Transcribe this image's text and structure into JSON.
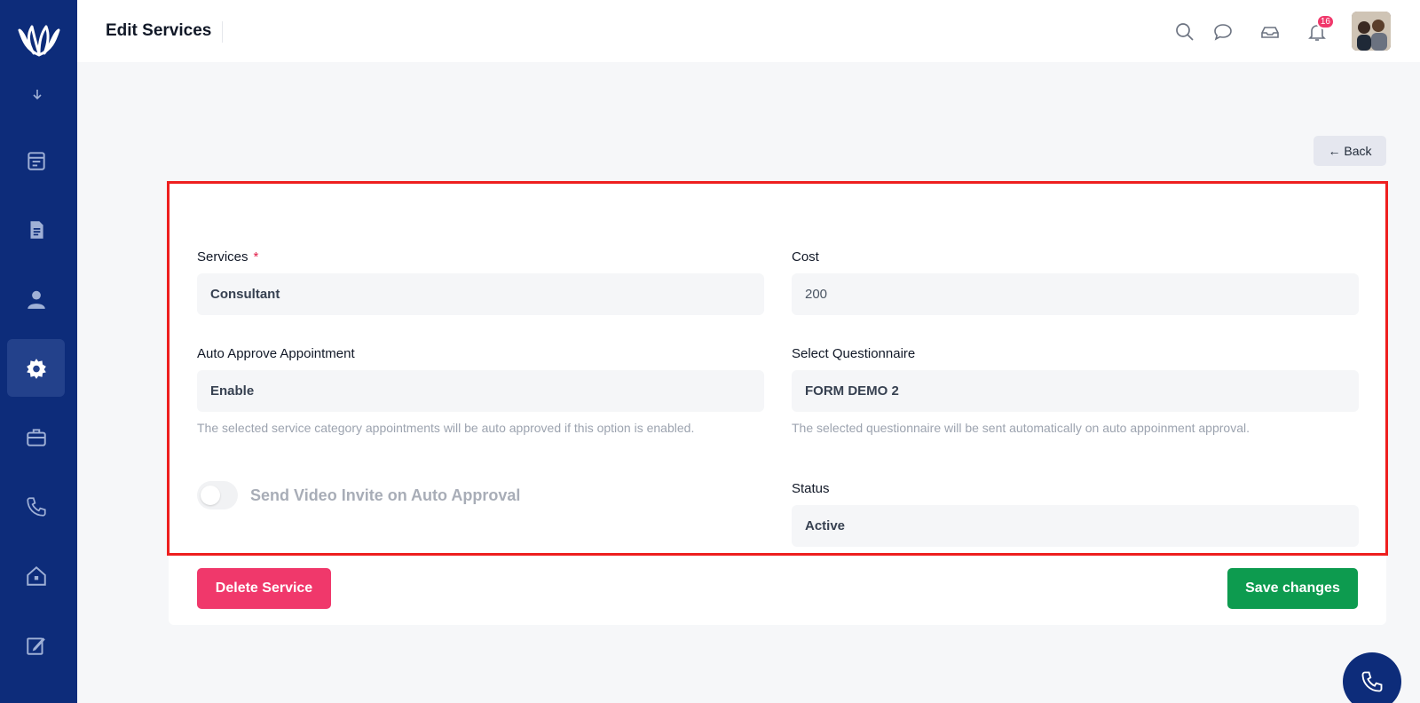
{
  "header": {
    "title": "Edit Services",
    "notification_count": "16"
  },
  "sidebar": {
    "items": [
      {
        "icon": "calendar-icon",
        "active": false
      },
      {
        "icon": "document-icon",
        "active": false
      },
      {
        "icon": "user-icon",
        "active": false
      },
      {
        "icon": "gear-icon",
        "active": true
      },
      {
        "icon": "briefcase-icon",
        "active": false
      },
      {
        "icon": "phone-icon",
        "active": false
      },
      {
        "icon": "home-icon",
        "active": false
      },
      {
        "icon": "edit-icon",
        "active": false
      }
    ]
  },
  "actions": {
    "back_label": "← Back"
  },
  "form": {
    "services": {
      "label": "Services",
      "required_mark": "*",
      "value": "Consultant"
    },
    "cost": {
      "label": "Cost",
      "value": "200"
    },
    "auto_approve": {
      "label": "Auto Approve Appointment",
      "value": "Enable",
      "help": "The selected service category appointments will be auto approved if this option is enabled."
    },
    "questionnaire": {
      "label": "Select Questionnaire",
      "value": "FORM DEMO 2",
      "help": "The selected questionnaire will be sent automatically on auto appoinment approval."
    },
    "video_invite": {
      "label": "Send Video Invite on Auto Approval",
      "enabled": false
    },
    "status": {
      "label": "Status",
      "value": "Active"
    }
  },
  "buttons": {
    "delete": "Delete Service",
    "save": "Save changes"
  },
  "colors": {
    "sidebar": "#0d2c7a",
    "delete": "#f0386b",
    "save": "#0d9b4f",
    "highlight": "#ee1f1f"
  }
}
